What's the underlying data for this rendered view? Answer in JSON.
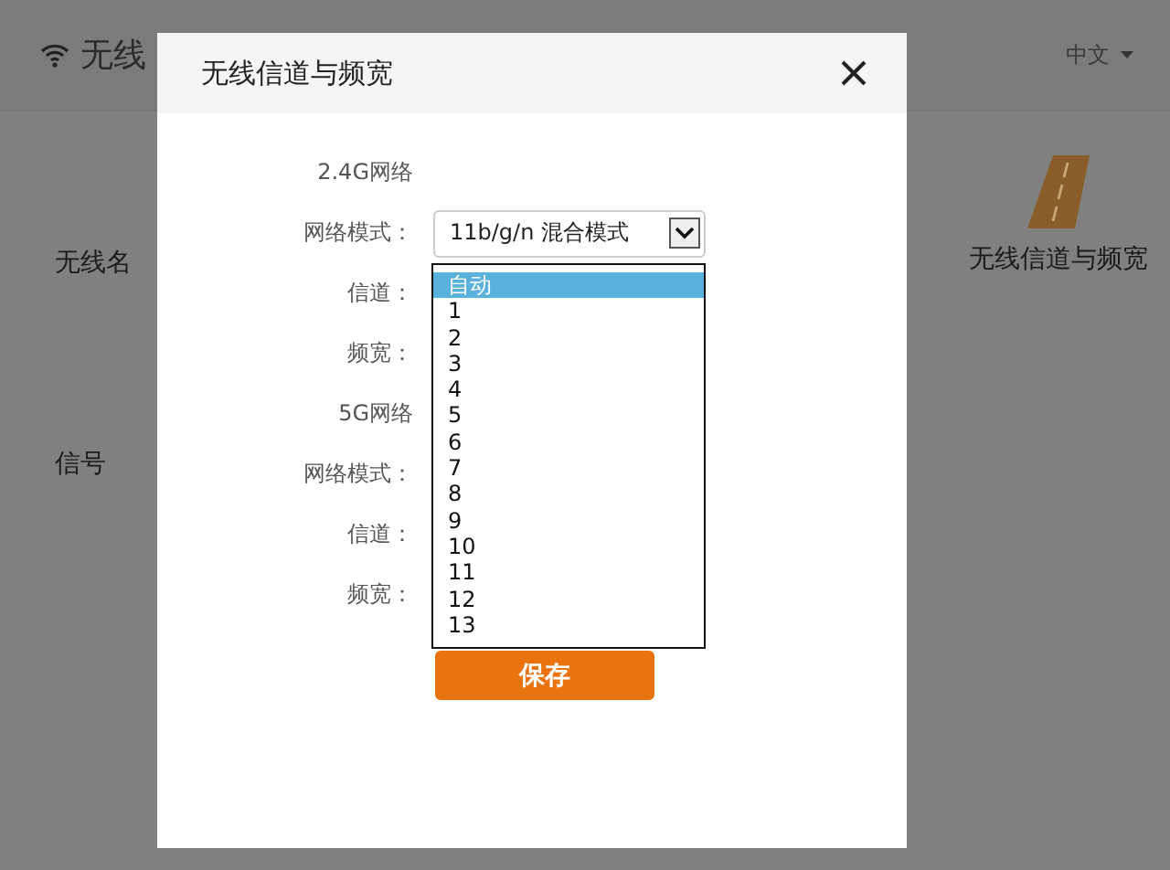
{
  "page": {
    "title": "无线",
    "language": "中文",
    "left_items": [
      {
        "label": "无线名"
      },
      {
        "label": "信号"
      }
    ],
    "right_items": [
      {
        "label": "无线信道与频宽"
      }
    ]
  },
  "dialog": {
    "title": "无线信道与频宽",
    "sections": [
      {
        "heading": "2.4G网络",
        "fields": [
          {
            "label": "网络模式：",
            "value": "11b/g/n 混合模式"
          },
          {
            "label": "信道："
          },
          {
            "label": "频宽："
          }
        ]
      },
      {
        "heading": "5G网络",
        "fields": [
          {
            "label": "网络模式："
          },
          {
            "label": "信道："
          },
          {
            "label": "频宽："
          }
        ]
      }
    ],
    "dropdown": {
      "options": [
        {
          "label": "自动",
          "selected": true
        },
        {
          "label": "1",
          "selected": false
        },
        {
          "label": "2",
          "selected": false
        },
        {
          "label": "3",
          "selected": false
        },
        {
          "label": "4",
          "selected": false
        },
        {
          "label": "5",
          "selected": false
        },
        {
          "label": "6",
          "selected": false
        },
        {
          "label": "7",
          "selected": false
        },
        {
          "label": "8",
          "selected": false
        },
        {
          "label": "9",
          "selected": false
        },
        {
          "label": "10",
          "selected": false
        },
        {
          "label": "11",
          "selected": false
        },
        {
          "label": "12",
          "selected": false
        },
        {
          "label": "13",
          "selected": false
        }
      ]
    },
    "save_button": "保存"
  }
}
